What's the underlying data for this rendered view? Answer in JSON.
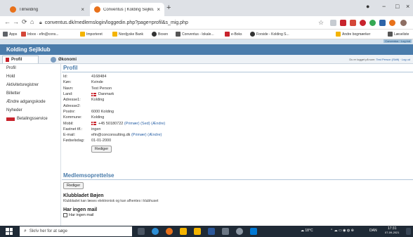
{
  "browser": {
    "tabs": [
      {
        "title": "Tilmelding",
        "close": "×"
      },
      {
        "title": "Conventus | Kolding Sejlklub | Ko",
        "close": "×"
      }
    ],
    "new_tab": "+",
    "window_controls": {
      "profile": "●",
      "minimize": "−",
      "maximize": "□",
      "close": "×"
    },
    "nav": {
      "back": "←",
      "forward": "→",
      "reload": "⟳",
      "home": "⌂"
    },
    "url": "conventus.dk/medlemslogin/loggedin.php?page=profil&s_mig.php",
    "star": "☆",
    "bookmarks": [
      {
        "label": "Apps",
        "color": "#5f6368"
      },
      {
        "label": "Inbox - efin@cons...",
        "color": "#d44638"
      },
      {
        "label": "Importeret",
        "color": "#f4b400"
      },
      {
        "label": "Nordjyske Bank",
        "color": "#f4b400"
      },
      {
        "label": "Boxen",
        "color": "#333"
      },
      {
        "label": "Conventus - lokale...",
        "color": "#555"
      },
      {
        "label": "e-Boks",
        "color": "#c8232c"
      },
      {
        "label": "Forside - Kolding S...",
        "color": "#333"
      },
      {
        "label": "Andre bogmærker",
        "color": "#f4b400"
      },
      {
        "label": "Læseliste",
        "color": "#555"
      }
    ]
  },
  "site": {
    "topstrip_label": "Conventus · Log ind",
    "title": "Kolding Sejlklub",
    "subnav": [
      {
        "label": "Profil",
        "color": "#c8232c"
      },
      {
        "label": "Økonomi",
        "color": "#7a9cc0"
      }
    ],
    "login_text": "Du er logget på som:",
    "login_name": "Test Person",
    "login_links": "(Skift) · Log ud"
  },
  "sidebar": {
    "items": [
      "Profil",
      "Hold",
      "Aktivitetsregistrer",
      "Billetter",
      "Ændre adgangskode",
      "Nyheder",
      "Betalingsservice"
    ]
  },
  "profile": {
    "heading": "Profil",
    "fields": [
      {
        "label": "Id:",
        "value": "4168484"
      },
      {
        "label": "Køn:",
        "value": "Kvinde"
      },
      {
        "label": "Navn:",
        "value": "Test Person"
      },
      {
        "label": "Land:",
        "value": "Danmark",
        "flag": true
      },
      {
        "label": "Adresse1:",
        "value": "Kolding"
      },
      {
        "label": "Adresse2:",
        "value": ""
      },
      {
        "label": "Postnr:",
        "value": "6000 Kolding"
      },
      {
        "label": "Kommune:",
        "value": "Kolding"
      },
      {
        "label": "Mobil:",
        "value": "+45 50180722",
        "flag": true,
        "suffix": "(Primær) (Sed) (Ændre)"
      },
      {
        "label": "Fastnet tlf.:",
        "value": "ingen"
      },
      {
        "label": "E-mail:",
        "value": "efin@conconsulting.dk",
        "suffix": "(Primær) (Ændre)"
      },
      {
        "label": "Fødselsdag:",
        "value": "01-01-2000"
      }
    ],
    "edit_button": "Rediger"
  },
  "membership": {
    "heading": "Medlemsoprettelse",
    "edit_button": "Rediger",
    "newsletter_title": "Klubbladet Bøjen",
    "newsletter_text": "Klubbladet kan læses elektronisk og kan afhentes i klubhuset",
    "mail_title": "Har ingen mail",
    "mail_checkbox": "Har ingen mail"
  },
  "taskbar": {
    "search_placeholder": "Skriv her for at søge",
    "weather": "18°C",
    "lang": "DAN",
    "time": "17:31",
    "date": "07-09-2021"
  }
}
